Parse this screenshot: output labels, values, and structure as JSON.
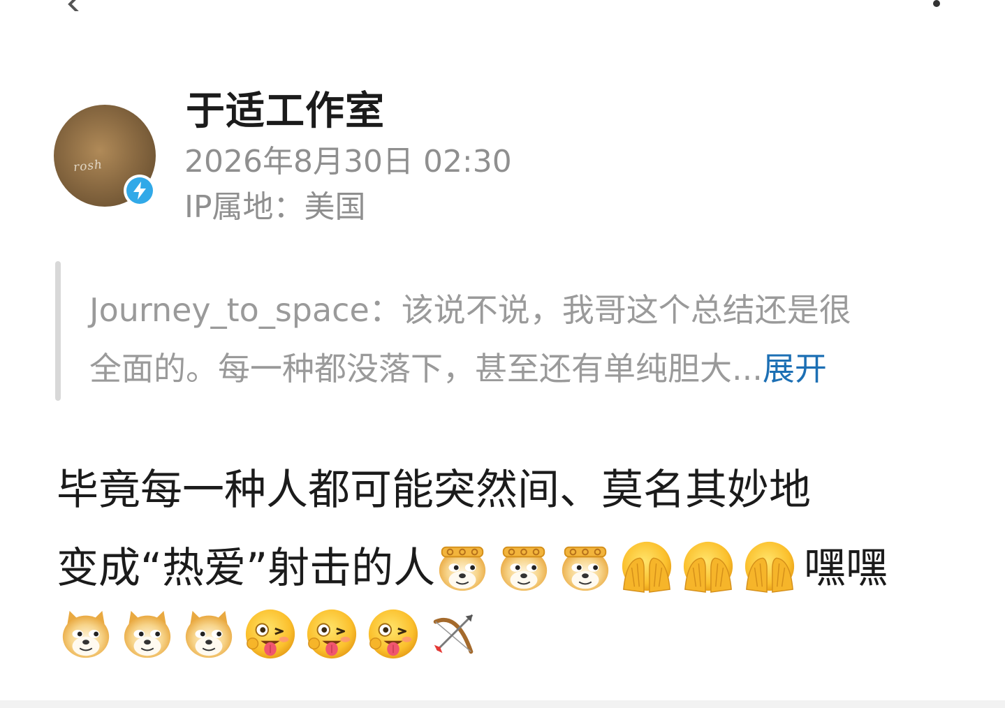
{
  "nav": {
    "back_icon": "chevron-left-icon",
    "more_icon": "more-vertical-icon"
  },
  "author": {
    "name": "于适工作室",
    "timestamp": "2026年8月30日 02:30",
    "ip_location": "IP属地：美国",
    "avatar_text": "rosh",
    "badge_icon": "lightning-verified-icon",
    "badge_color": "#31a9e8"
  },
  "quote": {
    "line1": "Journey_to_space：该说不说，我哥这个总结还是很",
    "line2": "全面的。每一种都没落下，甚至还有单纯胆大...",
    "expand_label": "展开",
    "link_color": "#1c6fb4"
  },
  "reply": {
    "line1": "毕竟每一种人都可能突然间、莫名其妙地",
    "line2_text": "变成“热爱”射击的人",
    "line2_suffix": "嘿嘿",
    "line2_emojis": [
      "doge-crown-emoji",
      "doge-crown-emoji",
      "doge-crown-emoji",
      "cover-face-emoji",
      "cover-face-emoji",
      "cover-face-emoji"
    ],
    "line3_emojis": [
      "doge-emoji",
      "doge-emoji",
      "doge-emoji",
      "wink-tongue-emoji",
      "wink-tongue-emoji",
      "wink-tongue-emoji",
      "bow-and-arrow-emoji"
    ]
  }
}
